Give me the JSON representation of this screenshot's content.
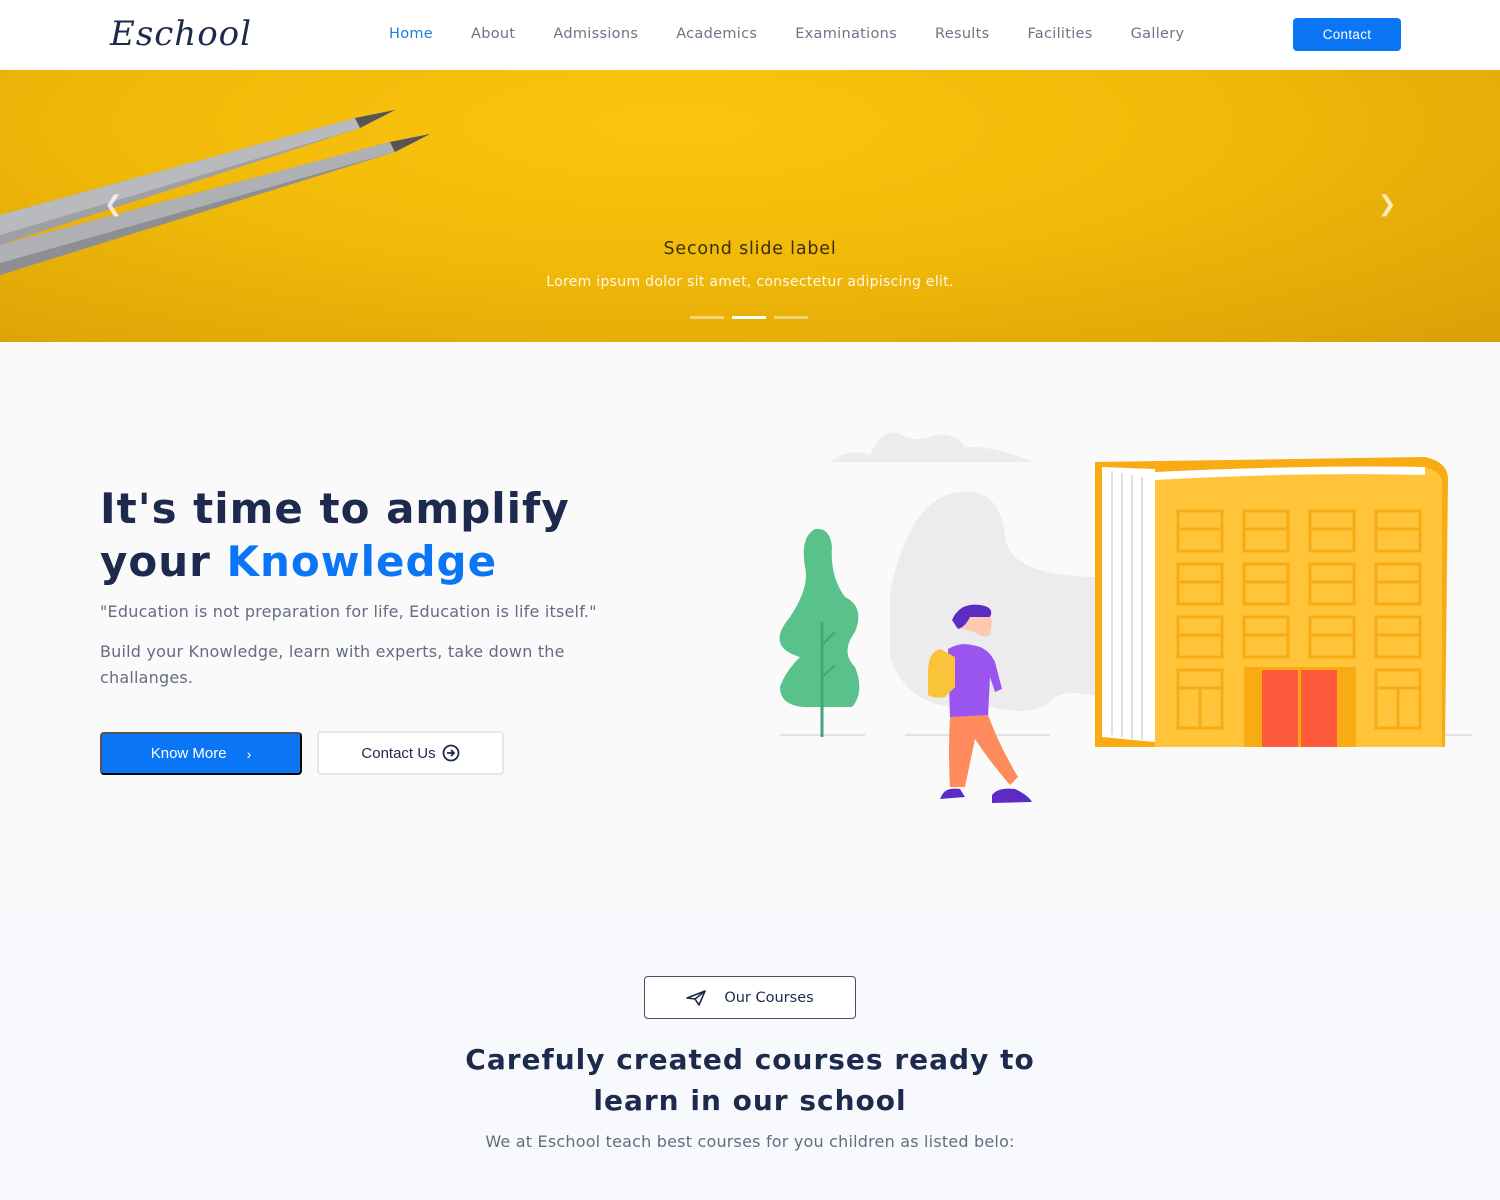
{
  "header": {
    "logo": "Eschool",
    "nav": [
      {
        "label": "Home",
        "active": true
      },
      {
        "label": "About"
      },
      {
        "label": "Admissions"
      },
      {
        "label": "Academics"
      },
      {
        "label": "Examinations"
      },
      {
        "label": "Results"
      },
      {
        "label": "Facilities"
      },
      {
        "label": "Gallery"
      }
    ],
    "contact_label": "Contact"
  },
  "hero": {
    "title": "Second slide label",
    "subtitle": "Lorem ipsum dolor sit amet, consectetur adipiscing elit.",
    "prev_icon": "chevron-left-icon",
    "next_icon": "chevron-right-icon",
    "slides_total": 3,
    "active_slide": 2
  },
  "intro": {
    "heading_line1": "It's time to amplify",
    "heading_line2_prefix": "your",
    "heading_highlight": "Knowledge",
    "quote": "\"Education is not preparation for life, Education is life itself.\"",
    "description": "Build your Knowledge, learn with experts, take down the challanges.",
    "know_more_label": "Know More",
    "contact_us_label": "Contact Us"
  },
  "courses": {
    "badge_label": "Our Courses",
    "heading_line1": "Carefuly created courses ready to",
    "heading_line2": "learn in our school",
    "subtitle": "We at Eschool teach best courses for you children as listed belo:"
  },
  "colors": {
    "primary": "#0a76f6",
    "hero_yellow": "#f2ba08",
    "navy": "#1d2a4d"
  }
}
